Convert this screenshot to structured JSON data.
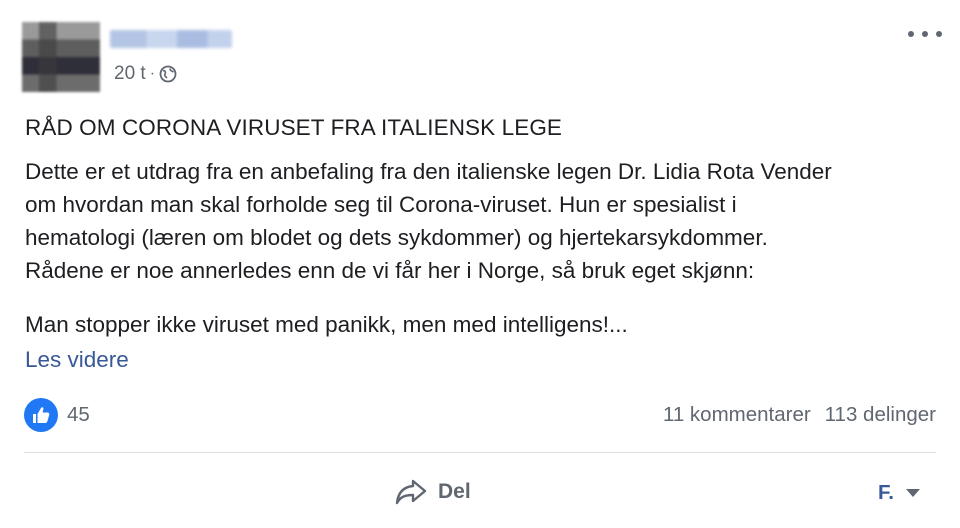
{
  "post": {
    "time": "20 t",
    "separator": "·",
    "audience_icon": "globe-icon",
    "title": "RÅD OM CORONA VIRUSET FRA ITALIENSK LEGE",
    "body_lines": [
      "Dette er et utdrag fra en anbefaling fra den italienske legen Dr. Lidia Rota Vender",
      "om hvordan man skal forholde seg til Corona-viruset. Hun er spesialist i",
      "hematologi (læren om blodet og dets sykdommer) og hjertekarsykdommer.",
      "Rådene er noe annerledes enn de vi får her i Norge, så bruk eget skjønn:"
    ],
    "body_line_2": "Man stopper ikke viruset med panikk, men med intelligens!...",
    "read_more": "Les videre"
  },
  "reactions": {
    "icon": "like-icon",
    "count": "45",
    "comments": "11 kommentarer",
    "shares": "113 delinger"
  },
  "actions": {
    "share_label": "Del",
    "account_label": "F."
  },
  "colors": {
    "like_blue": "#2078f4",
    "link_blue": "#385898",
    "meta_gray": "#606770",
    "text": "#1c1e21",
    "divider": "#dadde1"
  }
}
